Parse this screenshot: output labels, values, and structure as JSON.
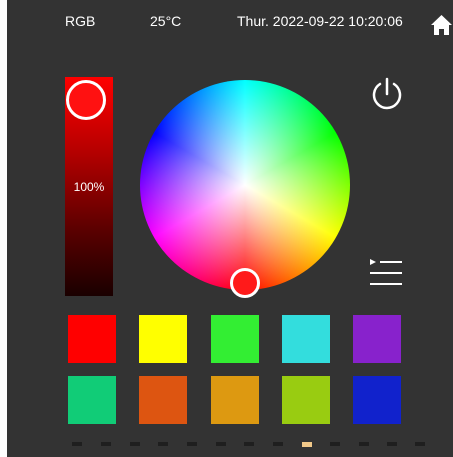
{
  "status_bar": {
    "mode": "RGB",
    "temperature": "25°C",
    "datetime": "Thur. 2022-09-22 10:20:06"
  },
  "icons": {
    "home": "home-icon",
    "power": "power-icon",
    "program": "program-list-icon"
  },
  "brightness": {
    "label": "100%",
    "value": 1.0,
    "color": "#ff0000"
  },
  "color_wheel": {
    "selected_color": "#ff1a1a"
  },
  "presets": [
    {
      "name": "red",
      "color": "#ff0000"
    },
    {
      "name": "yellow",
      "color": "#ffff00"
    },
    {
      "name": "green",
      "color": "#33ee33"
    },
    {
      "name": "cyan",
      "color": "#33dddd"
    },
    {
      "name": "purple",
      "color": "#8822cc"
    },
    {
      "name": "mint",
      "color": "#11cc77"
    },
    {
      "name": "orange",
      "color": "#dd5511"
    },
    {
      "name": "amber",
      "color": "#dd9911"
    },
    {
      "name": "lime",
      "color": "#99cc11"
    },
    {
      "name": "blue",
      "color": "#1122cc"
    }
  ],
  "pagination": {
    "total": 13,
    "active_index": 8
  }
}
